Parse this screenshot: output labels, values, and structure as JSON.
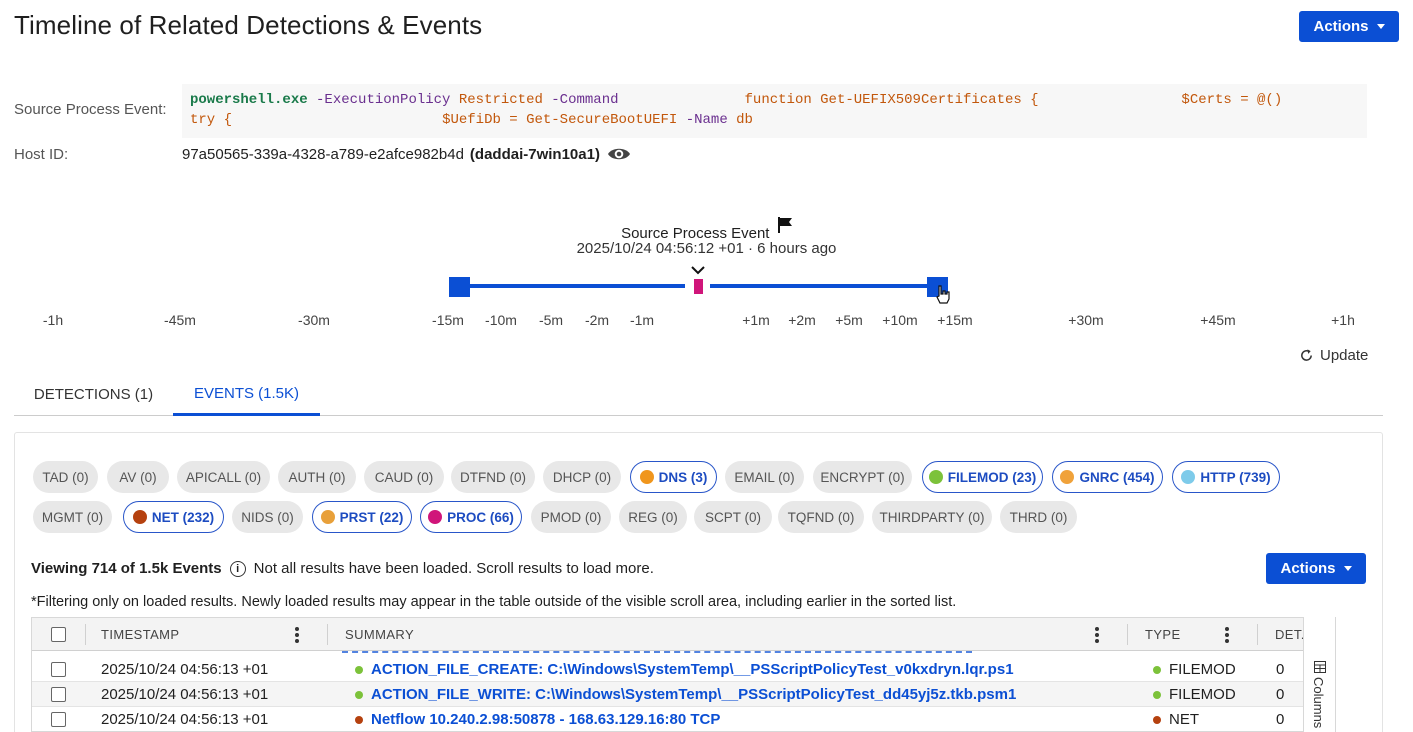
{
  "header": {
    "title": "Timeline of Related Detections & Events",
    "actions_label": "Actions"
  },
  "source_process": {
    "label": "Source Process Event:",
    "exe": "powershell.exe",
    "param1": "-ExecutionPolicy",
    "value1": "Restricted",
    "param2": "-Command",
    "func": "function Get-UEFIX509Certificates {",
    "certs": "$Certs = @()",
    "try": "try {",
    "uefi": "$UefiDb = Get-SecureBootUEFI",
    "param3": "-Name",
    "value3": "db"
  },
  "host": {
    "label": "Host ID:",
    "id": "97a50565-339a-4328-a789-e2afce982b4d",
    "name": "(daddai-7win10a1)",
    "icon": "eye-icon"
  },
  "timeline": {
    "title": "Source Process Event",
    "timestamp": "2025/10/24 04:56:12 +01 · 6 hours ago",
    "flag_icon": "flag-icon",
    "ticks": [
      "-1h",
      "-45m",
      "-30m",
      "-15m",
      "-10m",
      "-5m",
      "-2m",
      "-1m",
      "+1m",
      "+2m",
      "+5m",
      "+10m",
      "+15m",
      "+30m",
      "+45m",
      "+1h"
    ],
    "range_start": "-15m",
    "range_end": "+15m",
    "accent": "#0b4fd4",
    "marker_color": "#d0157a",
    "update_label": "Update"
  },
  "tabs": [
    {
      "label": "DETECTIONS (1)",
      "active": false
    },
    {
      "label": "EVENTS (1.5K)",
      "active": true
    }
  ],
  "filters": [
    {
      "label": "TAD (0)",
      "on": false
    },
    {
      "label": "AV (0)",
      "on": false
    },
    {
      "label": "APICALL (0)",
      "on": false
    },
    {
      "label": "AUTH (0)",
      "on": false
    },
    {
      "label": "CAUD (0)",
      "on": false
    },
    {
      "label": "DTFND (0)",
      "on": false
    },
    {
      "label": "DHCP (0)",
      "on": false
    },
    {
      "label": "DNS (3)",
      "on": true,
      "color": "#f0961d"
    },
    {
      "label": "EMAIL (0)",
      "on": false
    },
    {
      "label": "ENCRYPT (0)",
      "on": false
    },
    {
      "label": "FILEMOD (23)",
      "on": true,
      "color": "#7cc23a"
    },
    {
      "label": "GNRC (454)",
      "on": true,
      "color": "#f0a23a"
    },
    {
      "label": "HTTP (739)",
      "on": true,
      "color": "#7ecbea"
    },
    {
      "label": "MGMT (0)",
      "on": false
    },
    {
      "label": "NET (232)",
      "on": true,
      "color": "#b5410f"
    },
    {
      "label": "NIDS (0)",
      "on": false
    },
    {
      "label": "PRST (22)",
      "on": true,
      "color": "#e8a03a"
    },
    {
      "label": "PROC (66)",
      "on": true,
      "color": "#d0157a"
    },
    {
      "label": "PMOD (0)",
      "on": false
    },
    {
      "label": "REG (0)",
      "on": false
    },
    {
      "label": "SCPT (0)",
      "on": false
    },
    {
      "label": "TQFND (0)",
      "on": false
    },
    {
      "label": "THIRDPARTY (0)",
      "on": false
    },
    {
      "label": "THRD (0)",
      "on": false
    }
  ],
  "results": {
    "viewing": "Viewing 714 of 1.5k Events",
    "not_all": "Not all results have been loaded. Scroll results to load more.",
    "actions_label": "Actions",
    "filter_note": "*Filtering only on loaded results.  Newly loaded results may appear in the table outside of the visible scroll area, including earlier in the sorted list."
  },
  "table": {
    "columns": [
      "TIMESTAMP",
      "SUMMARY",
      "TYPE",
      "DET..."
    ],
    "columns_rail_label": "Columns",
    "rows": [
      {
        "timestamp": "2025/10/24 04:56:13 +01",
        "summary": "ACTION_FILE_CREATE: C:\\Windows\\SystemTemp\\__PSScriptPolicyTest_v0kxdryn.lqr.ps1",
        "type": "FILEMOD",
        "det": "0",
        "color": "#7cc23a"
      },
      {
        "timestamp": "2025/10/24 04:56:13 +01",
        "summary": "ACTION_FILE_WRITE: C:\\Windows\\SystemTemp\\__PSScriptPolicyTest_dd45yj5z.tkb.psm1",
        "type": "FILEMOD",
        "det": "0",
        "color": "#7cc23a"
      },
      {
        "timestamp": "2025/10/24 04:56:13 +01",
        "summary": "Netflow 10.240.2.98:50878 - 168.63.129.16:80 TCP",
        "type": "NET",
        "det": "0",
        "color": "#b5410f"
      }
    ]
  }
}
